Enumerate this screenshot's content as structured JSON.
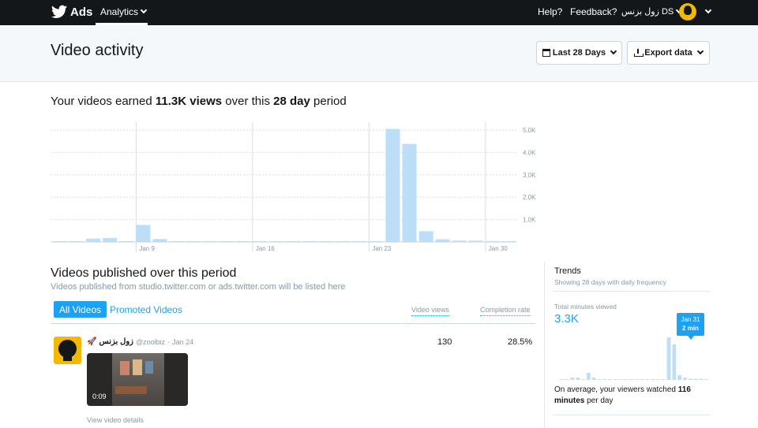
{
  "nav": {
    "brand": "Ads",
    "analytics_label": "Analytics",
    "help": "Help?",
    "feedback": "Feedback?",
    "account": "زول بزنس DS"
  },
  "header": {
    "title": "Video activity",
    "range_button": "Last 28 Days",
    "export_button": "Export data"
  },
  "summary": {
    "prefix": "Your videos earned ",
    "views": "11.3K views",
    "middle": " over this ",
    "period": "28 day",
    "suffix": " period"
  },
  "chart_data": {
    "type": "bar",
    "x": [
      "Jan 4",
      "Jan 5",
      "Jan 6",
      "Jan 7",
      "Jan 8",
      "Jan 9",
      "Jan 10",
      "Jan 11",
      "Jan 12",
      "Jan 13",
      "Jan 14",
      "Jan 15",
      "Jan 16",
      "Jan 17",
      "Jan 18",
      "Jan 19",
      "Jan 20",
      "Jan 21",
      "Jan 22",
      "Jan 23",
      "Jan 24",
      "Jan 25",
      "Jan 26",
      "Jan 27",
      "Jan 28",
      "Jan 29",
      "Jan 30",
      "Jan 31"
    ],
    "values": [
      20,
      20,
      150,
      180,
      20,
      760,
      130,
      20,
      10,
      10,
      10,
      10,
      10,
      10,
      10,
      10,
      10,
      10,
      10,
      10,
      5050,
      4380,
      480,
      120,
      60,
      60,
      40,
      20
    ],
    "ylim": [
      0,
      5000
    ],
    "yticks": [
      "1.0K",
      "2.0K",
      "3.0K",
      "4.0K",
      "5.0K"
    ],
    "xticks": [
      "Jan 9",
      "Jan 16",
      "Jan 23",
      "Jan 30"
    ],
    "xtick_index": [
      5,
      12,
      19,
      26
    ],
    "bar_color": "#bcdff7",
    "grid": true
  },
  "videos": {
    "title": "Videos published over this period",
    "subtitle": "Videos published from studio.twitter.com or ads.twitter.com will be listed here",
    "tab_all": "All Videos",
    "tab_promoted": "Promoted Videos",
    "col_views": "Video views",
    "col_completion": "Completion rate",
    "rows": [
      {
        "name": "زول بزنس",
        "handle": "@zoolbiz",
        "sep": "·",
        "date": "Jan 24",
        "views": "130",
        "completion": "28.5%",
        "duration": "0:09",
        "details_link": "View video details"
      }
    ]
  },
  "trends": {
    "title": "Trends",
    "subtitle": "Showing 28 days with daily frequency",
    "metric_label": "Total minutes viewed",
    "metric_value": "3.3K",
    "tooltip_date": "Jan 31",
    "tooltip_value": "2 min",
    "note_prefix": "On average, your viewers watched ",
    "note_value": "116 minutes",
    "note_suffix": " per day",
    "spark_values": [
      0,
      0,
      2,
      2,
      0,
      6,
      2,
      0,
      0,
      0,
      0,
      0,
      0,
      0,
      0,
      0,
      0,
      0,
      0,
      0,
      36,
      30,
      4,
      2,
      1,
      1,
      1,
      0
    ]
  }
}
